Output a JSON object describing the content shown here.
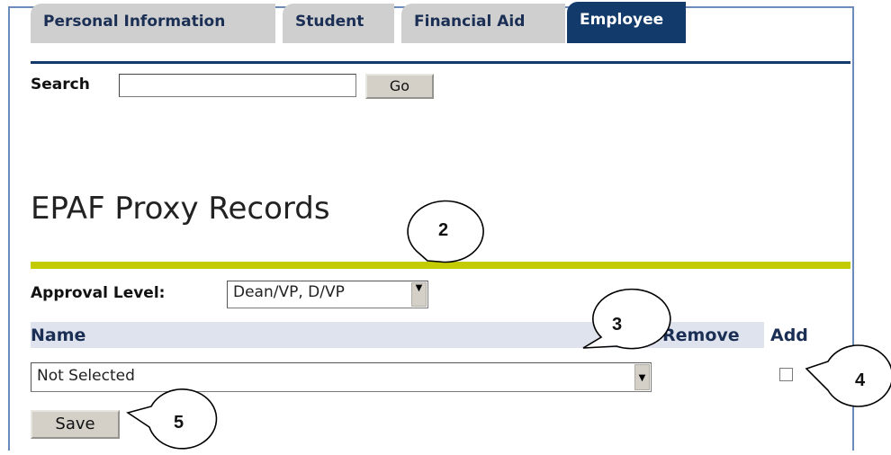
{
  "tabs": [
    {
      "label": "Personal Information",
      "active": false
    },
    {
      "label": "Student",
      "active": false
    },
    {
      "label": "Financial Aid",
      "active": false
    },
    {
      "label": "Employee",
      "active": true
    }
  ],
  "search": {
    "label": "Search",
    "value": "",
    "go_label": "Go"
  },
  "page_title": "EPAF Proxy Records",
  "approval": {
    "label": "Approval Level:",
    "selected": "Dean/VP, D/VP"
  },
  "table": {
    "headers": {
      "name": "Name",
      "remove": "Remove",
      "add": "Add"
    },
    "name_select": "Not Selected",
    "add_checked": false
  },
  "save_label": "Save",
  "callouts": [
    "2",
    "3",
    "4",
    "5"
  ],
  "colors": {
    "tab_active": "#123a6b",
    "tab_inactive": "#cfcfcf",
    "rule_olive": "#c2cc00",
    "frame": "#6b8cba"
  }
}
